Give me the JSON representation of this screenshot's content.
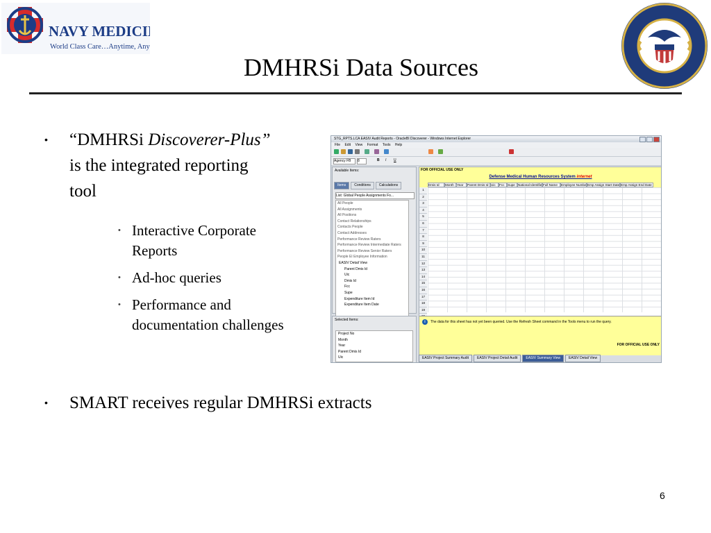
{
  "header": {
    "logo_left_name": "NAVY MEDICINE",
    "logo_left_tagline": "World Class Care…Anytime, Anywhere",
    "seal_text": "DEPARTMENT OF THE NAVY · BUREAU OF MEDICINE AND SURGERY",
    "title": "DMHRSi Data Sources"
  },
  "bullets": {
    "b1_open": "“DMHRSi ",
    "b1_italic": "Discoverer-Plus”",
    "b1_rest": " is the integrated reporting tool",
    "sub": [
      "Interactive Corporate Reports",
      "Ad-hoc queries",
      "Performance and documentation challenges"
    ],
    "b2": "SMART receives regular DMHRSi extracts"
  },
  "page_number": "6",
  "screenshot": {
    "window_title": "STG_RPTS.LCA EASIV Audit Reports - OracleBI Discoverer - Windows Internet Explorer",
    "menu": [
      "File",
      "Edit",
      "View",
      "Format",
      "Tools",
      "Help"
    ],
    "font_box": "Agency FB",
    "size_box": "8",
    "available_items_label": "Available Items:",
    "tabs": [
      "Items",
      "Conditions",
      "Calculations"
    ],
    "list_label": "List:",
    "list_value": "Global People Assignments Fo...",
    "tree": [
      "All People",
      "All Assignments",
      "All Positions",
      "Contact Relationships",
      "Contacts People",
      "Contact Addresses",
      "Performance Review Raters",
      "Performance Review Intermediate Raters",
      "Performance Review Senior Raters",
      "People EI Employee Information",
      "EASIV Detail View",
      "Parent Dmis Id",
      "Uic",
      "Dmis Id",
      "Fcc",
      "Supe",
      "Expenditure Item Id",
      "Expenditure Item Date"
    ],
    "selected_items_label": "Selected Items:",
    "selected": [
      "Project No",
      "Month",
      "Year",
      "Parent Dmis Id",
      "Uic"
    ],
    "fouo_top": "FOR OFFICIAL USE ONLY",
    "report_title": "Defense Medical Human Resources System ",
    "report_title_suffix": "internet",
    "columns": [
      "Dmis Id",
      "Month",
      "Year",
      "Parent Dmis Id",
      "Uic",
      "Fcc",
      "Supe",
      "National Identifier",
      "Full Name",
      "Employee Number",
      "Emp Assign Start Date",
      "Emp Assign End Date"
    ],
    "row_numbers": [
      "1",
      "2",
      "3",
      "4",
      "5",
      "6",
      "7",
      "8",
      "9",
      "10",
      "11",
      "12",
      "13",
      "14",
      "15",
      "16",
      "17",
      "18",
      "19",
      "20"
    ],
    "info_message": "The data for this sheet has not yet been queried. Use the Refresh Sheet command in the Tools menu to run the query.",
    "fouo_bottom": "FOR OFFICIAL USE ONLY",
    "sheet_tabs": [
      "EASIV Project Summary Audit",
      "EASIV Project Detail Audit",
      "EASIV Summary View",
      "EASIV Detail View"
    ]
  }
}
